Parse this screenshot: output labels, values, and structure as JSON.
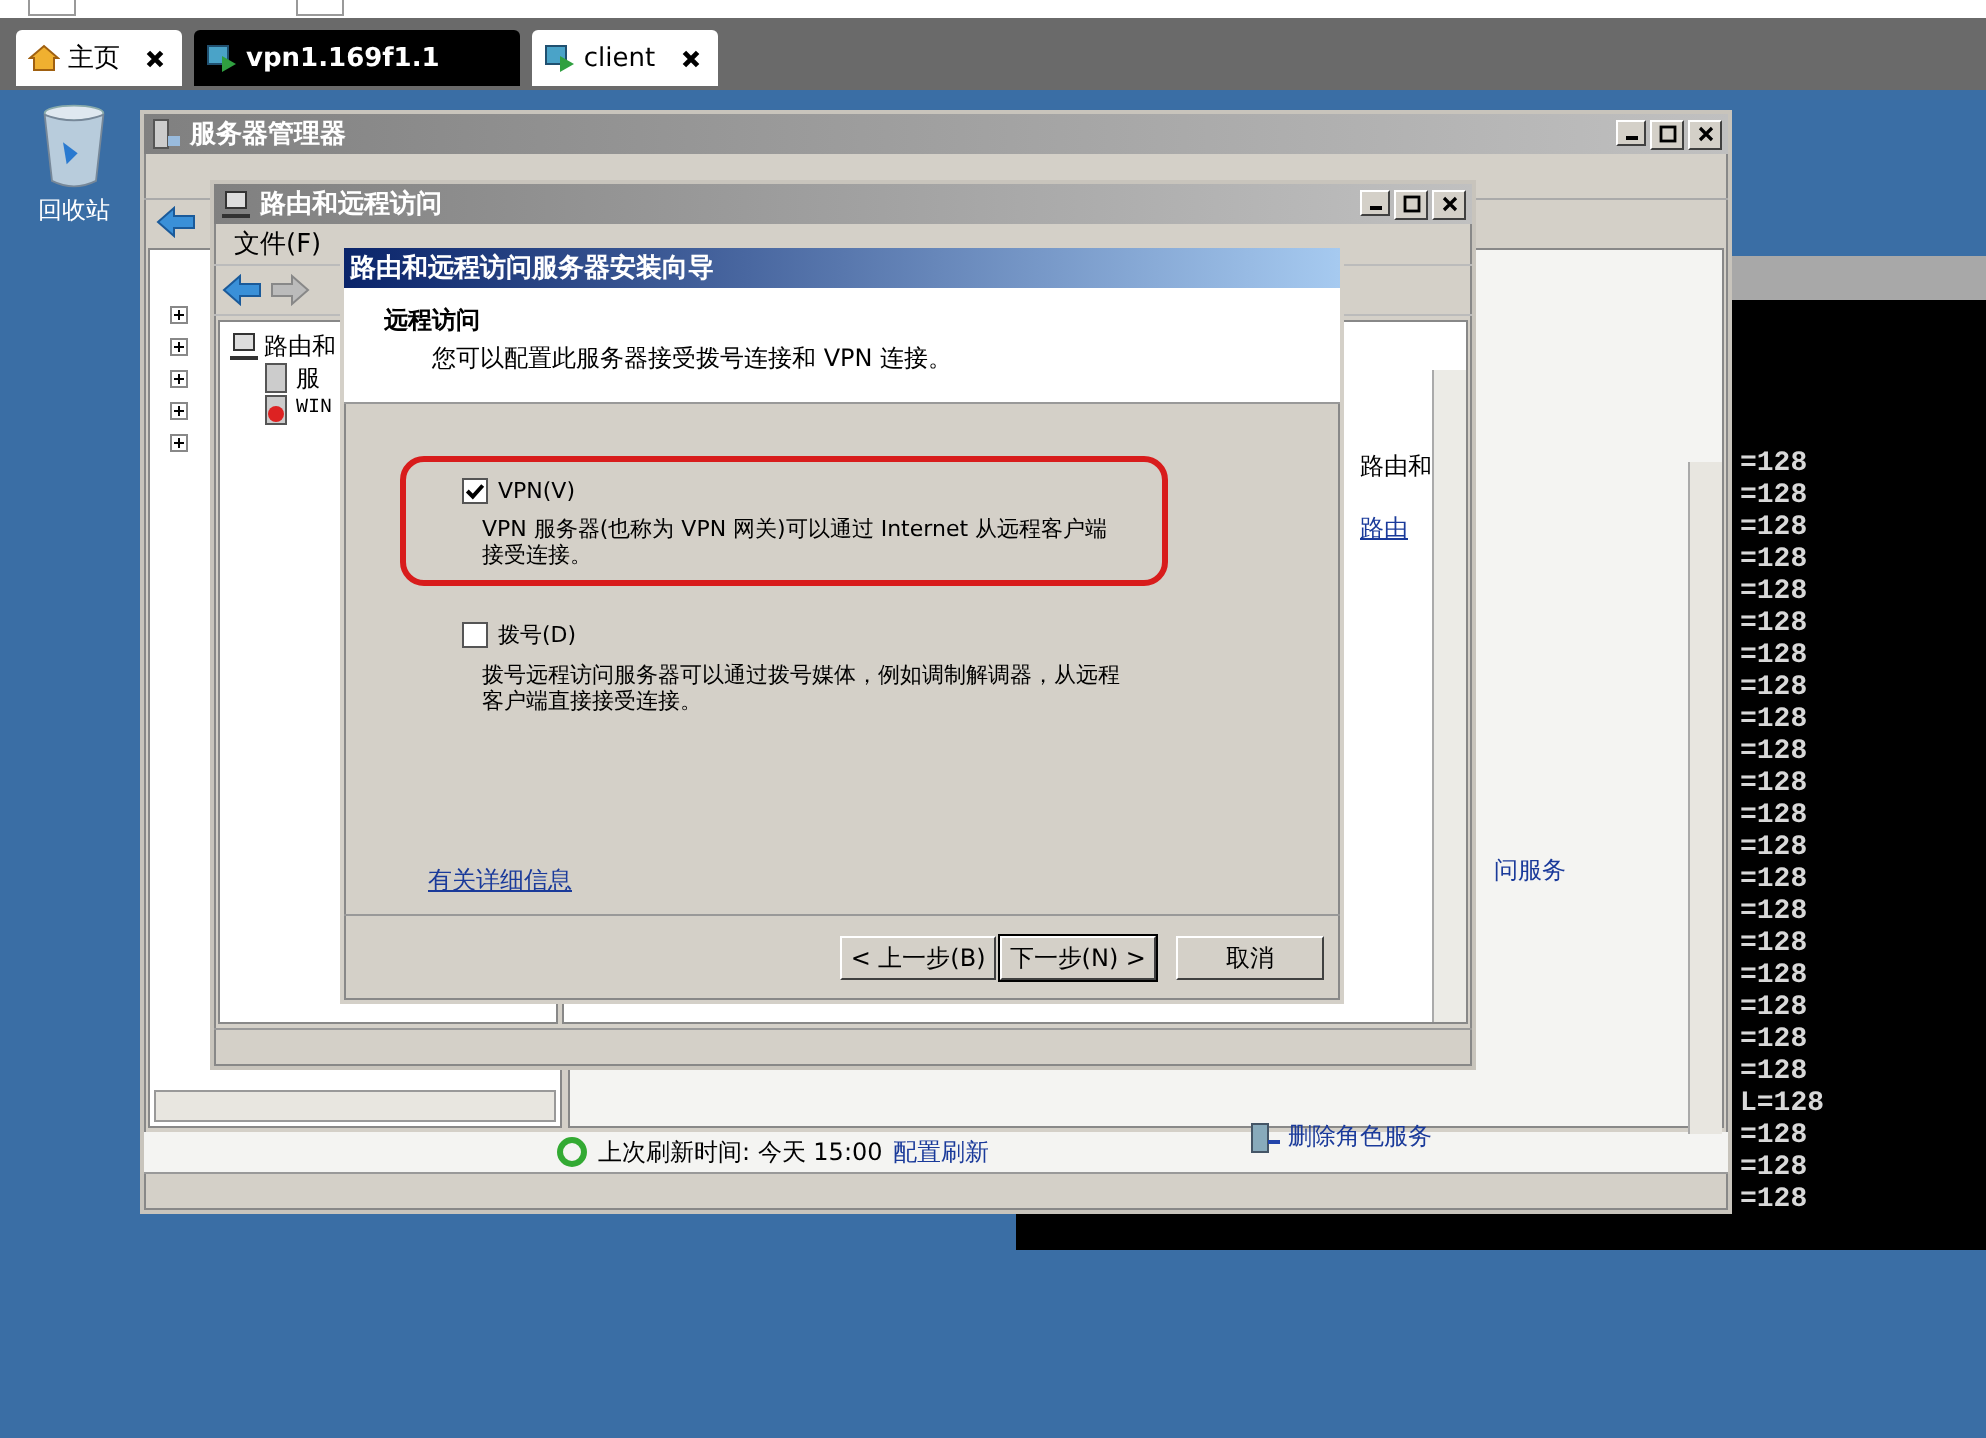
{
  "browser_tabs": [
    {
      "label": "主页",
      "selected": false,
      "closable": true
    },
    {
      "label": "vpn1.169f1.1",
      "selected": true,
      "closable": false
    },
    {
      "label": "client",
      "selected": false,
      "closable": true
    }
  ],
  "desktop_icons": [
    {
      "label": "回收站"
    }
  ],
  "terminal": {
    "lines": [
      "=128",
      "=128",
      "=128",
      "=128",
      "=128",
      "=128",
      "=128",
      "=128",
      "=128",
      "=128",
      "=128",
      "=128",
      "=128",
      "=128",
      "=128",
      "=128",
      "=128",
      "=128",
      "=128",
      "=128",
      "L=128",
      "=128",
      "=128",
      "=128"
    ]
  },
  "server_manager": {
    "title": "服务器管理器",
    "right_pane": {
      "task_link": "问服务",
      "remove_link": "删除角色服务"
    },
    "refresh": {
      "text": "上次刷新时间: 今天 15:00",
      "link": "配置刷新"
    }
  },
  "routing_window": {
    "title": "路由和远程访问",
    "menu": [
      "文件(F)"
    ],
    "tree": [
      {
        "label": "路由和",
        "children": [
          {
            "label": "服"
          },
          {
            "label": "WIN"
          }
        ]
      }
    ],
    "right_pane": {
      "text": "路由和",
      "link": "路由"
    }
  },
  "wizard": {
    "title": "路由和远程访问服务器安装向导",
    "heading": "远程访问",
    "subheading": "您可以配置此服务器接受拨号连接和 VPN 连接。",
    "options": [
      {
        "kind": "checkbox",
        "label": "VPN(V)",
        "description": "VPN 服务器(也称为 VPN 网关)可以通过 Internet 从远程客户端接受连接。",
        "checked": true,
        "highlighted": true
      },
      {
        "kind": "checkbox",
        "label": "拨号(D)",
        "description": "拨号远程访问服务器可以通过拨号媒体，例如调制解调器，从远程客户端直接接受连接。",
        "checked": false,
        "highlighted": false
      }
    ],
    "link": "有关详细信息",
    "buttons": [
      {
        "label": "< 上一步(B)",
        "default": false
      },
      {
        "label": "下一步(N) >",
        "default": true
      },
      {
        "label": "取消",
        "default": false
      }
    ]
  }
}
